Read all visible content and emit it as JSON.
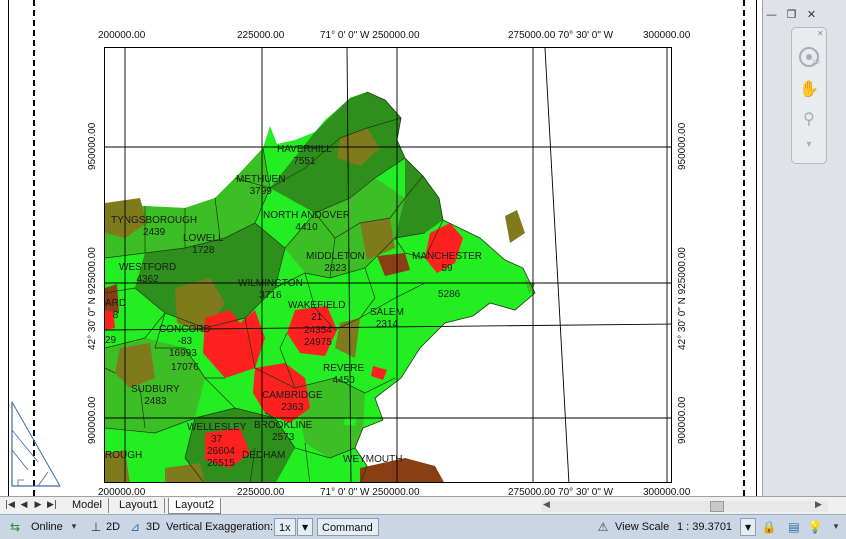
{
  "window": {
    "controls": {
      "minimize": "—",
      "restore": "❐",
      "close": "✕"
    }
  },
  "navigation_bar": {
    "icons": [
      "steering-wheel-icon",
      "pan-hand-icon",
      "zoom-icon",
      "orbit-icon"
    ]
  },
  "map": {
    "top_ticks": [
      "200000.00",
      "225000.00",
      "71° 0' 0\" W 250000.00",
      "275000.00 70° 30' 0\" W",
      "300000.00"
    ],
    "bottom_ticks": [
      "200000.00",
      "225000.00",
      "71° 0' 0\" W 250000.00",
      "275000.00 70° 30' 0\" W",
      "300000.00"
    ],
    "left_ticks": [
      "950000.00",
      "42° 30' 0\" N 925000.00",
      "900000.00"
    ],
    "right_ticks": [
      "950000.00",
      "42° 30' 0\" N 925000.00",
      "900000.00"
    ],
    "towns": [
      {
        "name": "HAVERHILL",
        "value": "7551"
      },
      {
        "name": "METHUEN",
        "value": "3799"
      },
      {
        "name": "NORTH ANDOVER",
        "value": "4410"
      },
      {
        "name": "TYNGSBOROUGH",
        "value": "2439"
      },
      {
        "name": "LOWELL",
        "value": "1728"
      },
      {
        "name": "WESTFORD",
        "value": "4362"
      },
      {
        "name": "MIDDLETON",
        "value": "2823"
      },
      {
        "name": "MANCHESTER",
        "value": "59"
      },
      {
        "name": "",
        "value": "5286"
      },
      {
        "name": "WILMINGTON",
        "value": "3716"
      },
      {
        "name": "WAKEFIELD",
        "value": "21"
      },
      {
        "name": "",
        "value": "24354"
      },
      {
        "name": "",
        "value": "24975"
      },
      {
        "name": "SALEM",
        "value": "2314"
      },
      {
        "name": "CONCORD",
        "value": "-83"
      },
      {
        "name": "",
        "value": "16993"
      },
      {
        "name": "",
        "value": "17076"
      },
      {
        "name": "ARD",
        "value": "8"
      },
      {
        "name": "",
        "value": "29"
      },
      {
        "name": "REVERE",
        "value": "4450"
      },
      {
        "name": "SUDBURY",
        "value": "2483"
      },
      {
        "name": "CAMBRIDGE",
        "value": "2363"
      },
      {
        "name": "WELLESLEY",
        "value": "37"
      },
      {
        "name": "BROOKLINE",
        "value": "2573"
      },
      {
        "name": "",
        "value": "26604"
      },
      {
        "name": "",
        "value": "26515"
      },
      {
        "name": "DEDHAM",
        "value": ""
      },
      {
        "name": "ROUGH",
        "value": ""
      },
      {
        "name": "WEYMOUTH",
        "value": ""
      }
    ]
  },
  "tabs": {
    "items": [
      "Model",
      "Layout1",
      "Layout2"
    ],
    "active": "Layout2"
  },
  "status_bar": {
    "online_label": "Online",
    "btn_2d": "2D",
    "btn_3d": "3D",
    "vertical_exaggeration_label": "Vertical Exaggeration:",
    "vertical_exaggeration_value": "1x",
    "command_label": "Command",
    "view_scale_label": "View Scale",
    "view_scale_value": "1 : 39.3701"
  },
  "colors": {
    "bright_green": "#22ee22",
    "mid_green": "#3cbf24",
    "dark_green": "#2f8f1c",
    "olive": "#7f7a1c",
    "red": "#ff2020",
    "brown": "#8a3e14",
    "status_bar_bg": "#c9d6e6",
    "accent_blue": "#3a6ea5"
  }
}
